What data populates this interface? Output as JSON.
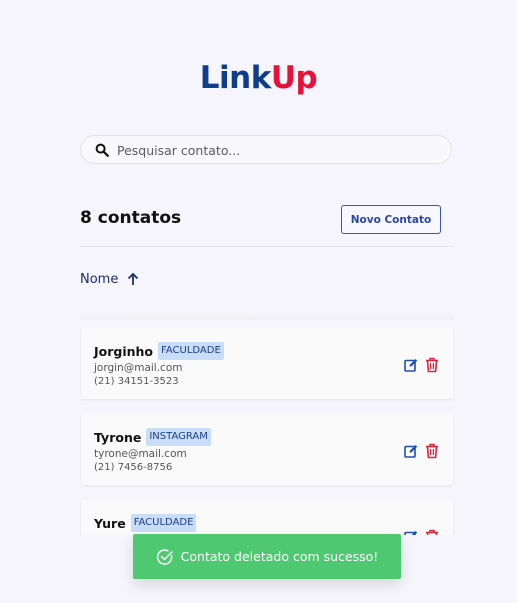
{
  "app": {
    "logo_part1": "Link",
    "logo_part2": "Up",
    "colors": {
      "logo_dark": "#0f3d8a",
      "logo_red": "#e5133c",
      "toast_green": "#4fc971",
      "button_blue": "#2c46a8"
    }
  },
  "search": {
    "placeholder": "Pesquisar contato...",
    "value": "",
    "icon": "search-icon"
  },
  "header": {
    "count_label": "8 contatos",
    "new_button_label": "Novo Contato"
  },
  "sort": {
    "label": "Nome",
    "icon": "arrow-up-icon"
  },
  "contacts": [
    {
      "name": "Jorginho",
      "tag": "FACULDADE",
      "email": "jorgin@mail.com",
      "phone": "(21) 34151-3523"
    },
    {
      "name": "Tyrone",
      "tag": "INSTAGRAM",
      "email": "tyrone@mail.com",
      "phone": "(21) 7456-8756"
    },
    {
      "name": "Yure",
      "tag": "FACULDADE",
      "email": "",
      "phone": ""
    }
  ],
  "toast": {
    "message": "Contato deletado com sucesso!",
    "icon": "check-circle-icon"
  }
}
